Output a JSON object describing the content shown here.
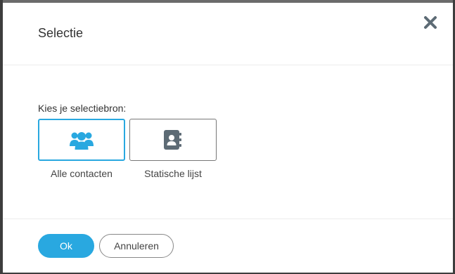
{
  "dialog": {
    "title": "Selectie",
    "close_icon": "close-icon"
  },
  "body": {
    "prompt": "Kies je selectiebron:",
    "options": [
      {
        "label": "Alle contacten",
        "icon": "users-icon",
        "selected": true
      },
      {
        "label": "Statische lijst",
        "icon": "address-book-icon",
        "selected": false
      }
    ]
  },
  "footer": {
    "ok_label": "Ok",
    "cancel_label": "Annuleren"
  },
  "colors": {
    "accent": "#29a8e0",
    "icon_gray": "#5d6b75",
    "close_gray": "#5d6b75"
  }
}
